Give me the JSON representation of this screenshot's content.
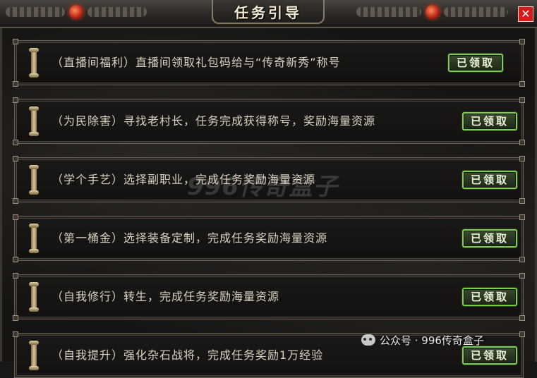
{
  "window": {
    "title": "任务引导",
    "close_label": "✕"
  },
  "quests": [
    {
      "text": "（直播间福利）直播间领取礼包码给与“传奇新秀”称号",
      "status": "已领取"
    },
    {
      "text": "（为民除害）寻找老村长，任务完成获得称号，奖励海量资源",
      "status": "已领取"
    },
    {
      "text": "（学个手艺）选择副职业，完成任务奖励海量资源",
      "status": "已领取"
    },
    {
      "text": "（第一桶金）选择装备定制，完成任务奖励海量资源",
      "status": "已领取"
    },
    {
      "text": "（自我修行）转生，完成任务奖励海量资源",
      "status": "已领取"
    },
    {
      "text": "（自我提升）强化杂石战将，完成任务奖励1万经验",
      "status": "已领取"
    }
  ],
  "watermark": {
    "logo_text": "996传奇盒子",
    "source_text": "公众号 · 996传奇盒子"
  },
  "colors": {
    "button_border": "#7ccf4f",
    "close_button": "#d81a1a"
  }
}
